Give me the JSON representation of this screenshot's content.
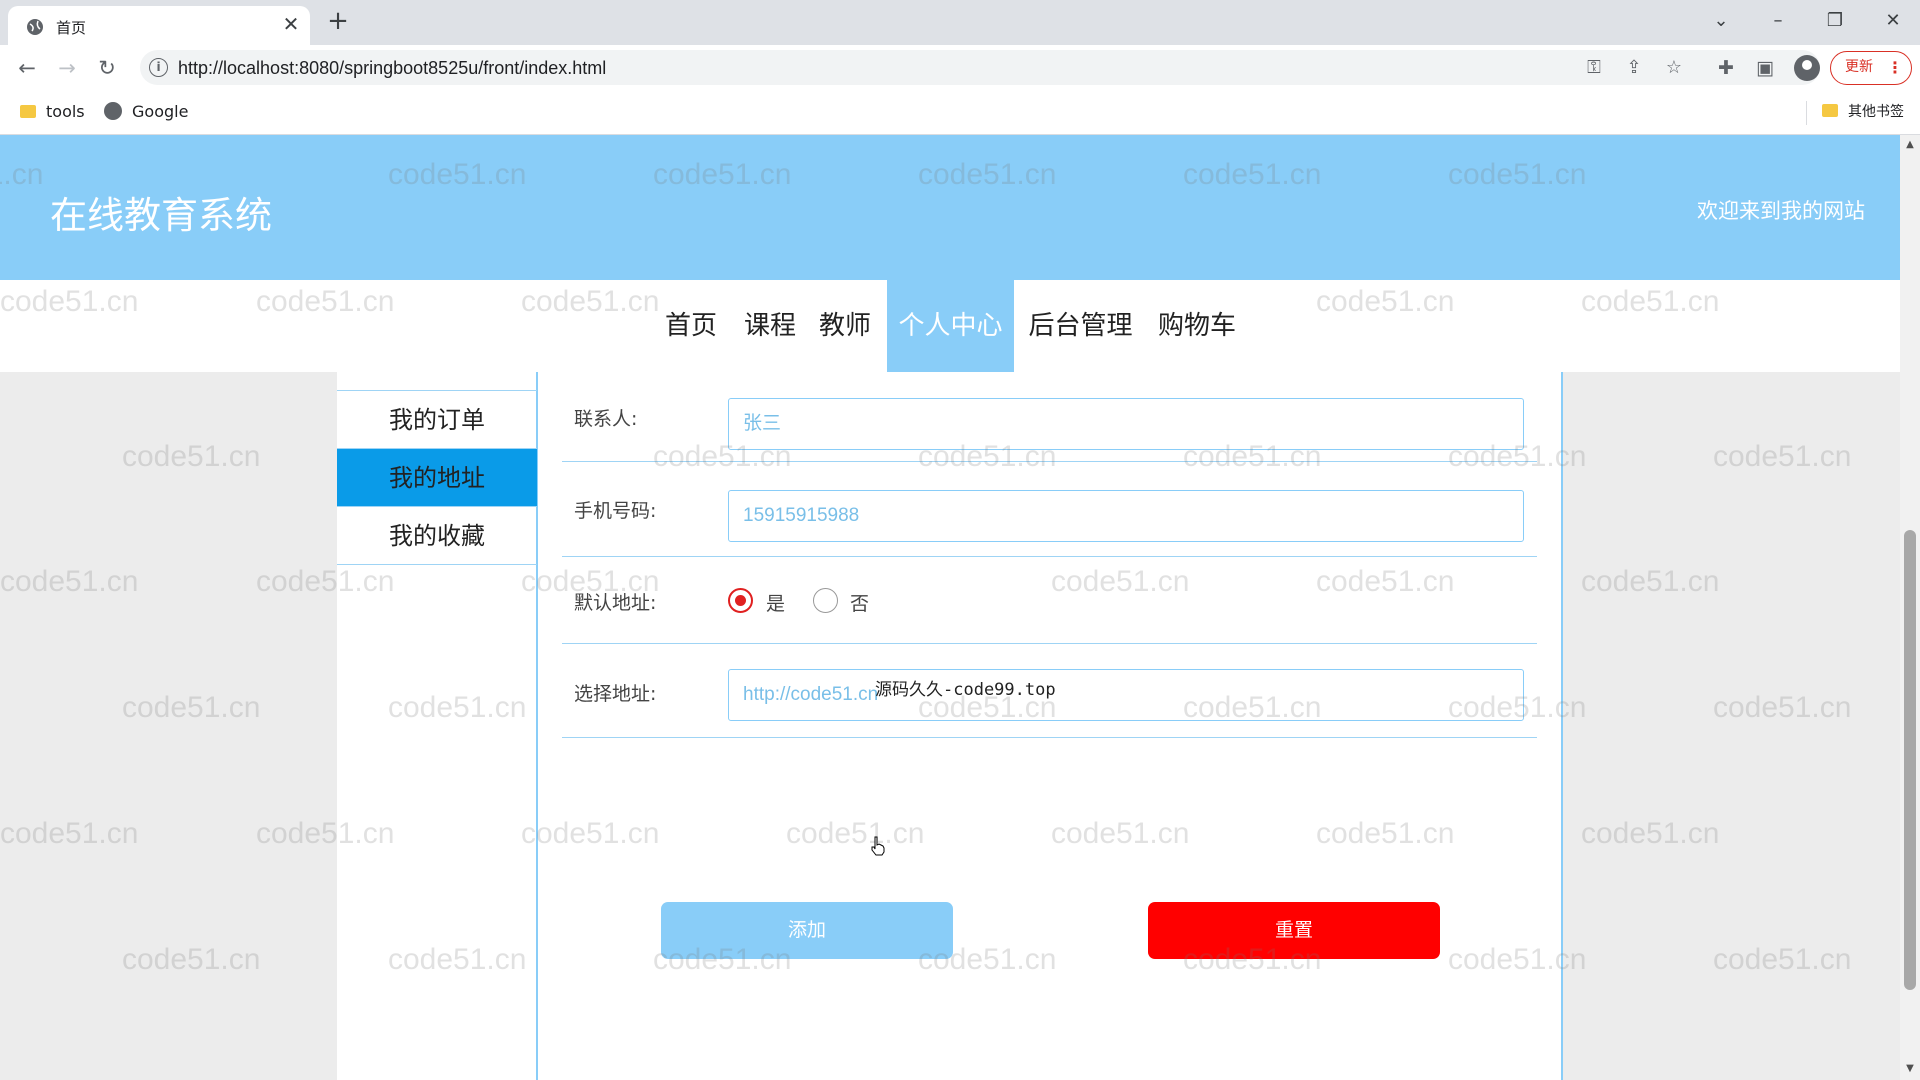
{
  "browser": {
    "tab_title": "首页",
    "url": "http://localhost:8080/springboot8525u/front/index.html",
    "update_label": "更新",
    "bookmarks": [
      {
        "label": "tools",
        "icon": "folder-icon"
      },
      {
        "label": "Google",
        "icon": "globe-icon"
      }
    ],
    "other_bookmarks": "其他书签"
  },
  "site": {
    "title": "在线教育系统",
    "welcome": "欢迎来到我的网站",
    "nav": [
      "首页",
      "课程",
      "教师",
      "个人中心",
      "后台管理",
      "购物车"
    ],
    "active_nav": "个人中心"
  },
  "sidebar": {
    "items": [
      "我的订单",
      "我的地址",
      "我的收藏"
    ],
    "active": "我的地址"
  },
  "form": {
    "contact": {
      "label": "联系人:",
      "placeholder": "张三"
    },
    "phone": {
      "label": "手机号码:",
      "placeholder": "15915915988"
    },
    "default_address": {
      "label": "默认地址:",
      "options": [
        "是",
        "否"
      ],
      "selected": "是"
    },
    "address": {
      "label": "选择地址:",
      "placeholder": "http://code51.cn"
    },
    "add_button": "添加",
    "reset_button": "重置"
  },
  "overlay_note": "源码久久-code99.top",
  "watermark_text": "code51.cn",
  "colors": {
    "header_bg": "#89cdf8",
    "sidebar_active": "#0a9be8",
    "reset_button": "#ff0000",
    "radio_selected": "#e02020"
  }
}
